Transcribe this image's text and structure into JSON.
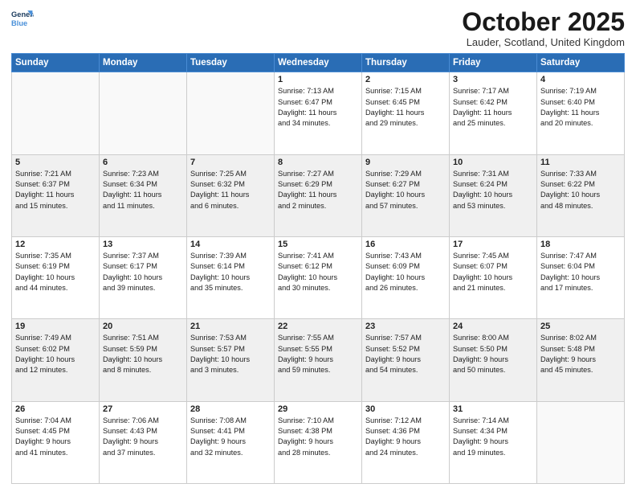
{
  "header": {
    "logo_line1": "General",
    "logo_line2": "Blue",
    "month_title": "October 2025",
    "location": "Lauder, Scotland, United Kingdom"
  },
  "days_of_week": [
    "Sunday",
    "Monday",
    "Tuesday",
    "Wednesday",
    "Thursday",
    "Friday",
    "Saturday"
  ],
  "weeks": [
    [
      {
        "day": "",
        "detail": "",
        "empty": true
      },
      {
        "day": "",
        "detail": "",
        "empty": true
      },
      {
        "day": "",
        "detail": "",
        "empty": true
      },
      {
        "day": "1",
        "detail": "Sunrise: 7:13 AM\nSunset: 6:47 PM\nDaylight: 11 hours\nand 34 minutes."
      },
      {
        "day": "2",
        "detail": "Sunrise: 7:15 AM\nSunset: 6:45 PM\nDaylight: 11 hours\nand 29 minutes."
      },
      {
        "day": "3",
        "detail": "Sunrise: 7:17 AM\nSunset: 6:42 PM\nDaylight: 11 hours\nand 25 minutes."
      },
      {
        "day": "4",
        "detail": "Sunrise: 7:19 AM\nSunset: 6:40 PM\nDaylight: 11 hours\nand 20 minutes."
      }
    ],
    [
      {
        "day": "5",
        "detail": "Sunrise: 7:21 AM\nSunset: 6:37 PM\nDaylight: 11 hours\nand 15 minutes.",
        "shaded": true
      },
      {
        "day": "6",
        "detail": "Sunrise: 7:23 AM\nSunset: 6:34 PM\nDaylight: 11 hours\nand 11 minutes.",
        "shaded": true
      },
      {
        "day": "7",
        "detail": "Sunrise: 7:25 AM\nSunset: 6:32 PM\nDaylight: 11 hours\nand 6 minutes.",
        "shaded": true
      },
      {
        "day": "8",
        "detail": "Sunrise: 7:27 AM\nSunset: 6:29 PM\nDaylight: 11 hours\nand 2 minutes.",
        "shaded": true
      },
      {
        "day": "9",
        "detail": "Sunrise: 7:29 AM\nSunset: 6:27 PM\nDaylight: 10 hours\nand 57 minutes.",
        "shaded": true
      },
      {
        "day": "10",
        "detail": "Sunrise: 7:31 AM\nSunset: 6:24 PM\nDaylight: 10 hours\nand 53 minutes.",
        "shaded": true
      },
      {
        "day": "11",
        "detail": "Sunrise: 7:33 AM\nSunset: 6:22 PM\nDaylight: 10 hours\nand 48 minutes.",
        "shaded": true
      }
    ],
    [
      {
        "day": "12",
        "detail": "Sunrise: 7:35 AM\nSunset: 6:19 PM\nDaylight: 10 hours\nand 44 minutes."
      },
      {
        "day": "13",
        "detail": "Sunrise: 7:37 AM\nSunset: 6:17 PM\nDaylight: 10 hours\nand 39 minutes."
      },
      {
        "day": "14",
        "detail": "Sunrise: 7:39 AM\nSunset: 6:14 PM\nDaylight: 10 hours\nand 35 minutes."
      },
      {
        "day": "15",
        "detail": "Sunrise: 7:41 AM\nSunset: 6:12 PM\nDaylight: 10 hours\nand 30 minutes."
      },
      {
        "day": "16",
        "detail": "Sunrise: 7:43 AM\nSunset: 6:09 PM\nDaylight: 10 hours\nand 26 minutes."
      },
      {
        "day": "17",
        "detail": "Sunrise: 7:45 AM\nSunset: 6:07 PM\nDaylight: 10 hours\nand 21 minutes."
      },
      {
        "day": "18",
        "detail": "Sunrise: 7:47 AM\nSunset: 6:04 PM\nDaylight: 10 hours\nand 17 minutes."
      }
    ],
    [
      {
        "day": "19",
        "detail": "Sunrise: 7:49 AM\nSunset: 6:02 PM\nDaylight: 10 hours\nand 12 minutes.",
        "shaded": true
      },
      {
        "day": "20",
        "detail": "Sunrise: 7:51 AM\nSunset: 5:59 PM\nDaylight: 10 hours\nand 8 minutes.",
        "shaded": true
      },
      {
        "day": "21",
        "detail": "Sunrise: 7:53 AM\nSunset: 5:57 PM\nDaylight: 10 hours\nand 3 minutes.",
        "shaded": true
      },
      {
        "day": "22",
        "detail": "Sunrise: 7:55 AM\nSunset: 5:55 PM\nDaylight: 9 hours\nand 59 minutes.",
        "shaded": true
      },
      {
        "day": "23",
        "detail": "Sunrise: 7:57 AM\nSunset: 5:52 PM\nDaylight: 9 hours\nand 54 minutes.",
        "shaded": true
      },
      {
        "day": "24",
        "detail": "Sunrise: 8:00 AM\nSunset: 5:50 PM\nDaylight: 9 hours\nand 50 minutes.",
        "shaded": true
      },
      {
        "day": "25",
        "detail": "Sunrise: 8:02 AM\nSunset: 5:48 PM\nDaylight: 9 hours\nand 45 minutes.",
        "shaded": true
      }
    ],
    [
      {
        "day": "26",
        "detail": "Sunrise: 7:04 AM\nSunset: 4:45 PM\nDaylight: 9 hours\nand 41 minutes."
      },
      {
        "day": "27",
        "detail": "Sunrise: 7:06 AM\nSunset: 4:43 PM\nDaylight: 9 hours\nand 37 minutes."
      },
      {
        "day": "28",
        "detail": "Sunrise: 7:08 AM\nSunset: 4:41 PM\nDaylight: 9 hours\nand 32 minutes."
      },
      {
        "day": "29",
        "detail": "Sunrise: 7:10 AM\nSunset: 4:38 PM\nDaylight: 9 hours\nand 28 minutes."
      },
      {
        "day": "30",
        "detail": "Sunrise: 7:12 AM\nSunset: 4:36 PM\nDaylight: 9 hours\nand 24 minutes."
      },
      {
        "day": "31",
        "detail": "Sunrise: 7:14 AM\nSunset: 4:34 PM\nDaylight: 9 hours\nand 19 minutes."
      },
      {
        "day": "",
        "detail": "",
        "empty": true
      }
    ]
  ]
}
